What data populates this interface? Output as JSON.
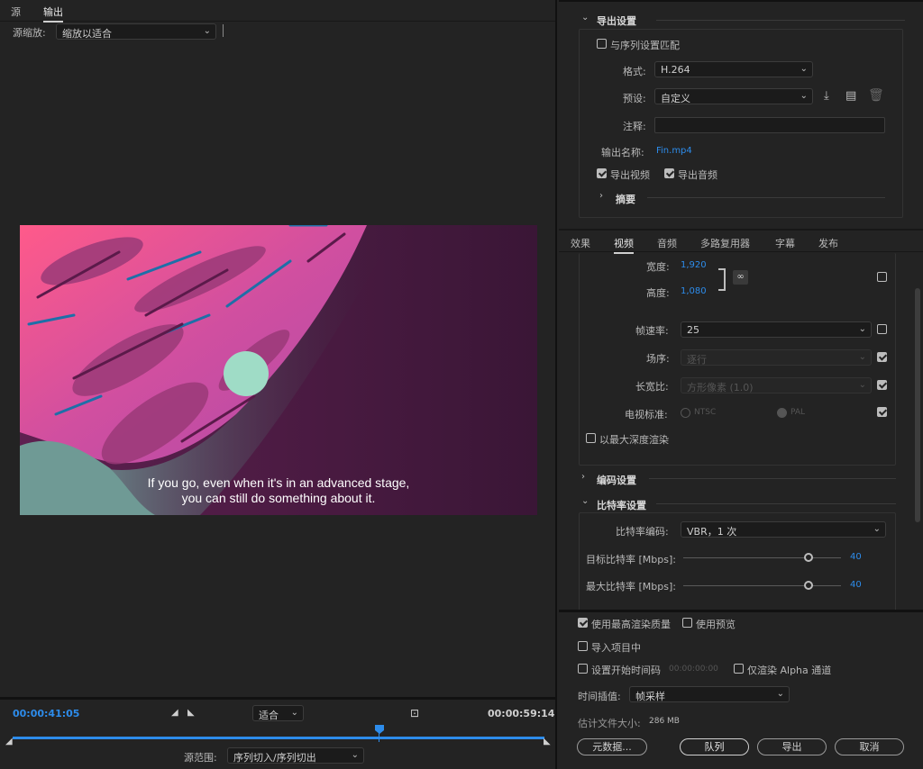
{
  "left_panel": {
    "tabs": [
      "源",
      "输出"
    ],
    "source_scale_label": "源缩放:",
    "source_scale_value": "缩放以适合",
    "subtitle_line1": "If you go, even when it's in an advanced stage,",
    "subtitle_line2": "you can still do something about it.",
    "timecode_in": "00:00:41:05",
    "timecode_out": "00:00:59:14",
    "fit_value": "适合",
    "source_range_label": "源范围:",
    "source_range_value": "序列切入/序列切出",
    "playhead_position": 0.69
  },
  "export_settings": {
    "section_title": "导出设置",
    "match_sequence_label": "与序列设置匹配",
    "format_label": "格式:",
    "format_value": "H.264",
    "preset_label": "预设:",
    "preset_value": "自定义",
    "comment_label": "注释:",
    "output_name_label": "输出名称:",
    "output_name_value": "Fin.mp4",
    "export_video_label": "导出视频",
    "export_audio_label": "导出音频",
    "summary_label": "摘要"
  },
  "tabs": [
    "效果",
    "视频",
    "音频",
    "多路复用器",
    "字幕",
    "发布"
  ],
  "video": {
    "width_label": "宽度:",
    "width_value": "1,920",
    "height_label": "高度:",
    "height_value": "1,080",
    "frame_rate_label": "帧速率:",
    "frame_rate_value": "25",
    "field_order_label": "场序:",
    "field_order_value": "逐行",
    "aspect_label": "长宽比:",
    "aspect_value": "方形像素 (1.0)",
    "tv_standard_label": "电视标准:",
    "ntsc_label": "NTSC",
    "pal_label": "PAL",
    "max_depth_label": "以最大深度渲染",
    "encoding_settings": "编码设置",
    "bitrate_settings": "比特率设置",
    "bitrate_encoding_label": "比特率编码:",
    "bitrate_encoding_value": "VBR，1 次",
    "target_bitrate_label": "目标比特率 [Mbps]:",
    "target_bitrate_value": "40",
    "max_bitrate_label": "最大比特率 [Mbps]:",
    "max_bitrate_value": "40"
  },
  "bottom": {
    "max_render_quality": "使用最高渲染质量",
    "use_previews": "使用预览",
    "import_into_project": "导入项目中",
    "set_start_timecode": "设置开始时间码",
    "start_timecode_value": "00:00:00:00",
    "render_alpha_only": "仅渲染 Alpha 通道",
    "time_interpolation_label": "时间插值:",
    "time_interpolation_value": "帧采样",
    "estimated_size_label": "估计文件大小:",
    "estimated_size_value": "286 MB",
    "metadata_button": "元数据...",
    "queue_button": "队列",
    "export_button": "导出",
    "cancel_button": "取消"
  }
}
